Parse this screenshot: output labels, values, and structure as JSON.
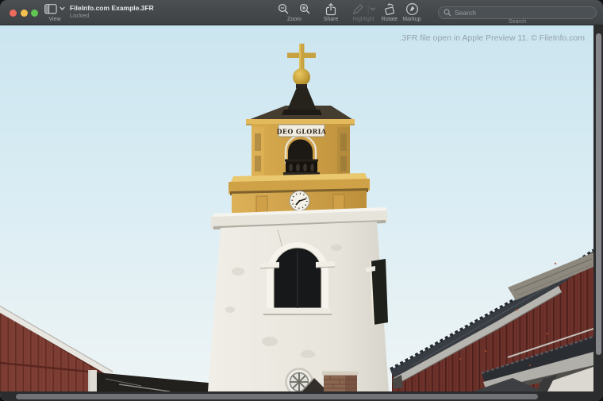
{
  "window": {
    "title": "FileInfo.com Example.3FR",
    "subtitle": "Locked"
  },
  "titlebar": {
    "view_label": "View",
    "zoom_label": "Zoom",
    "share_label": "Share",
    "highlight_label": "Highlight",
    "rotate_label": "Rotate",
    "markup_label": "Markup",
    "search_label": "Search",
    "search_placeholder": "Search"
  },
  "content": {
    "watermark": ".3FR file open in Apple Preview 11. © FileInfo.com",
    "photo": {
      "subject": "Church tower with golden cross, clock and DEO GLORIA sign, flanked by red wooden buildings under a pale blue sky",
      "sign_text": "DEO GLORIA"
    }
  },
  "icons": {
    "traffic_lights": [
      "close",
      "minimize",
      "zoom"
    ],
    "toolbar": [
      "sidebar-icon",
      "chevron-down-icon",
      "magnifier-minus-icon",
      "magnifier-plus-icon",
      "share-icon",
      "highlighter-pen-icon",
      "rotate-icon",
      "markup-pen-icon",
      "search-icon"
    ]
  },
  "colors": {
    "titlebar": "#45494c",
    "traffic_red": "#ec6a5e",
    "traffic_yellow": "#f5bf4f",
    "traffic_green": "#61c554",
    "sky_top": "#cbe5f0",
    "tower_yellow": "#d2a449",
    "falu_red": "#7e3e34",
    "scrollbar_track": "#2b2c2d",
    "scrollbar_thumb": "#85878b"
  }
}
